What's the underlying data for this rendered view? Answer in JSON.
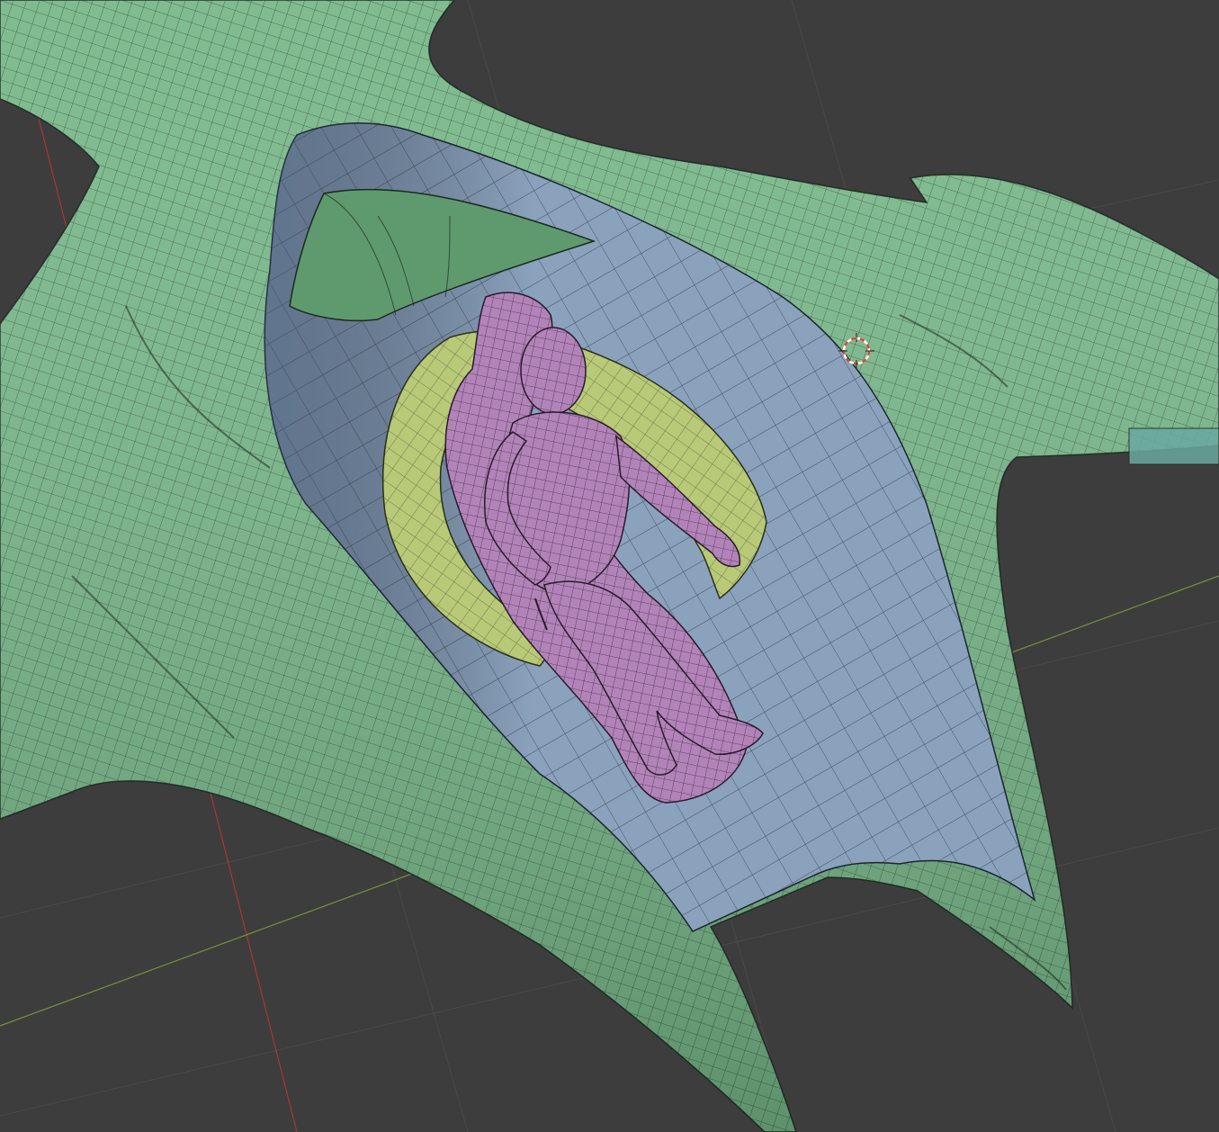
{
  "viewport": {
    "mode": "3d-viewport-wireframe-overlay",
    "shading": "solid-with-wireframe"
  },
  "colors": {
    "background": "#3d3d3d",
    "grid_line": "#4a4a4a",
    "axis_x": "#c0392b",
    "axis_y": "#7fa33a",
    "hull": "#79b88a",
    "hull_shadow": "#5e9a6d",
    "cockpit_interior": "#8ba2bd",
    "cockpit_shadow": "#6b829c",
    "canopy_flap": "#5f9a6e",
    "seat_frame": "#b8c978",
    "pilot": "#b283b8",
    "wire": "#1c2a20",
    "cursor_ring": "#d9472f"
  },
  "objects": [
    {
      "name": "ship-hull",
      "icon": "mesh-icon"
    },
    {
      "name": "cockpit-cavity",
      "icon": "mesh-icon"
    },
    {
      "name": "canopy-flap",
      "icon": "mesh-icon"
    },
    {
      "name": "seat-cradle",
      "icon": "mesh-icon"
    },
    {
      "name": "pilot-figure",
      "icon": "armature-icon"
    }
  ],
  "cursor": {
    "icon": "3d-cursor-icon"
  }
}
